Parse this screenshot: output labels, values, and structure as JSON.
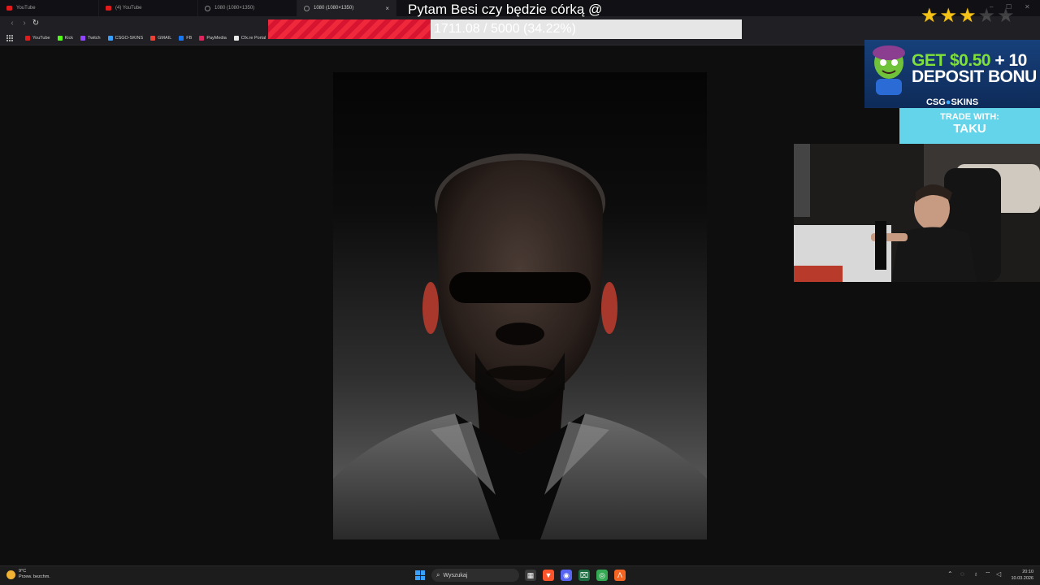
{
  "browser": {
    "tabs": [
      {
        "title": "YouTube",
        "icon": "youtube-icon",
        "active": false
      },
      {
        "title": "(4) YouTube",
        "icon": "youtube-icon",
        "active": false
      },
      {
        "title": "1080 (1080×1350)",
        "icon": "globe-icon",
        "active": false
      },
      {
        "title": "1080 (1080×1350)",
        "icon": "globe-icon",
        "active": true
      }
    ],
    "tab_close": "×",
    "nav": {
      "back": "‹",
      "forward": "›",
      "reload": "↻"
    },
    "bookmarks": [
      {
        "label": "YouTube",
        "color": "#e01b1b"
      },
      {
        "label": "Kick",
        "color": "#53fc18"
      },
      {
        "label": "Twitch",
        "color": "#9146ff"
      },
      {
        "label": "CSGO-SKINS",
        "color": "#3aa0ff"
      },
      {
        "label": "GMAIL",
        "color": "#ea4335"
      },
      {
        "label": "FB",
        "color": "#1877f2"
      },
      {
        "label": "PayMedia",
        "color": "#e0245e"
      },
      {
        "label": "Cfx.re Portal",
        "color": "#e8e8e8"
      }
    ],
    "window_controls": {
      "minimize": "–",
      "maximize": "☐",
      "close": "✕"
    }
  },
  "stream": {
    "title": "Pytam Besi czy będzie córką @",
    "goal": {
      "text": "1711.08 / 5000 (34.22%)",
      "fraction": 0.3422,
      "fill_color": "#f0283c"
    },
    "stars": {
      "filled": 3,
      "total": 5,
      "symbol": "★"
    },
    "ad": {
      "line1_highlight": "GET $0.50",
      "line1_rest": " + 10",
      "line2": "DEPOSIT BONU",
      "brand_left": "CSG",
      "brand_dot": "●",
      "brand_right": "SKINS",
      "trade_label": "TRADE WITH:",
      "trade_name": "TAKU"
    }
  },
  "taskbar": {
    "weather": {
      "temp": "9°C",
      "condition": "Przew. bezchm."
    },
    "search_placeholder": "Wyszukaj",
    "apps": [
      {
        "name": "file-explorer",
        "glyph": "▦",
        "color": "#3a3a3a"
      },
      {
        "name": "brave",
        "glyph": "▼",
        "color": "#fb542b"
      },
      {
        "name": "discord",
        "glyph": "◉",
        "color": "#5865f2"
      },
      {
        "name": "excel",
        "glyph": "⌧",
        "color": "#1d6f42"
      },
      {
        "name": "chrome",
        "glyph": "◎",
        "color": "#34a853"
      },
      {
        "name": "app",
        "glyph": "Λ",
        "color": "#f26522"
      }
    ],
    "clock": {
      "time": "20:10",
      "date": "10.03.2026"
    }
  }
}
